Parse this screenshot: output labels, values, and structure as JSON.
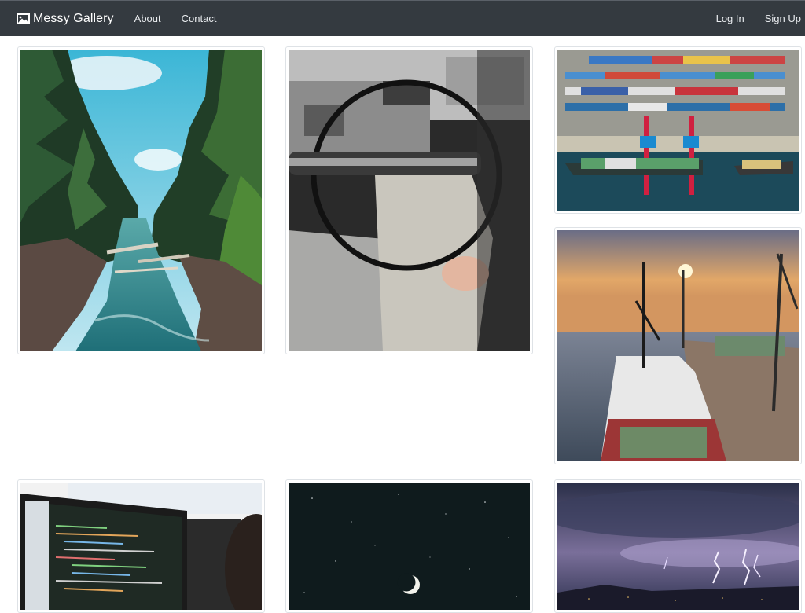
{
  "navbar": {
    "brand": "Messy Gallery",
    "brand_icon": "image-icon",
    "links_left": [
      "About",
      "Contact"
    ],
    "links_right": [
      "Log In",
      "Sign Up"
    ]
  },
  "gallery": {
    "photos": [
      "forest-river-photo",
      "car-steering-wheel-photo",
      "container-port-aerial-photo",
      "harbor-ship-sunset-photo",
      "computer-code-monitors-photo",
      "crescent-moon-night-sky-photo",
      "lightning-storm-photo"
    ]
  }
}
